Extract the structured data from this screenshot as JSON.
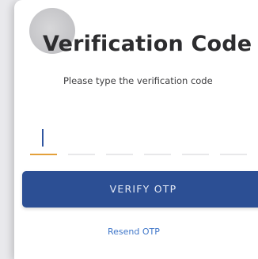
{
  "card": {
    "title": "Verification Code",
    "subtitle": "Please type the verification code"
  },
  "otp": {
    "slots": [
      "",
      "",
      "",
      "",
      "",
      ""
    ],
    "active_index": 0
  },
  "actions": {
    "verify_label": "VERIFY OTP",
    "resend_label": "Resend OTP"
  },
  "colors": {
    "primary": "#2c4f94",
    "active_underline": "#e3a03a",
    "link": "#3f76c9"
  }
}
